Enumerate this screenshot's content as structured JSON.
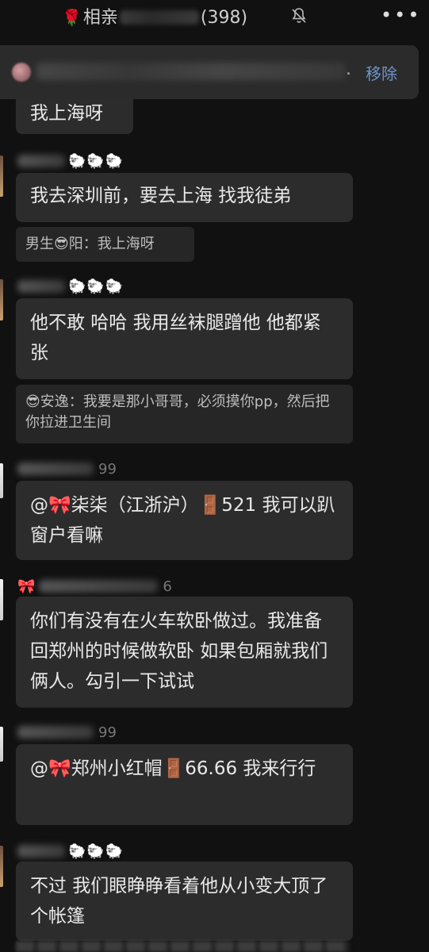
{
  "header": {
    "title_prefix": "相亲",
    "member_count": "(398)",
    "rose_icon": "🌹"
  },
  "notice": {
    "remove_label": "移除"
  },
  "messages": [
    {
      "id": "m0",
      "text": "我上海呀"
    },
    {
      "id": "m1",
      "name_emoji": "🐑🐑🐑",
      "text": "我去深圳前，要去上海 找我徒弟",
      "quote": "男生😎阳：我上海呀"
    },
    {
      "id": "m2",
      "name_emoji": "🐑🐑🐑",
      "text": "他不敢 哈哈 我用丝袜腿蹭他 他都紧张",
      "quote": "😎安逸：我要是那小哥哥，必须摸你pp，然后把你拉进卫生间"
    },
    {
      "id": "m3",
      "name_suffix": "99",
      "text": "@🎀柒柒（江浙沪）🚪521  我可以趴窗户看嘛"
    },
    {
      "id": "m4",
      "name_emoji": "🎀",
      "name_suffix": "6",
      "text": "你们有没有在火车软卧做过。我准备回郑州的时候做软卧 如果包厢就我们俩人。勾引一下试试"
    },
    {
      "id": "m5",
      "name_suffix": "99",
      "text": "@🎀郑州小红帽🚪66.66  我来行行"
    },
    {
      "id": "m6",
      "name_emoji": "🐑🐑🐑",
      "text": "不过 我们眼睁睁看着他从小变大顶了个帐篷"
    }
  ]
}
